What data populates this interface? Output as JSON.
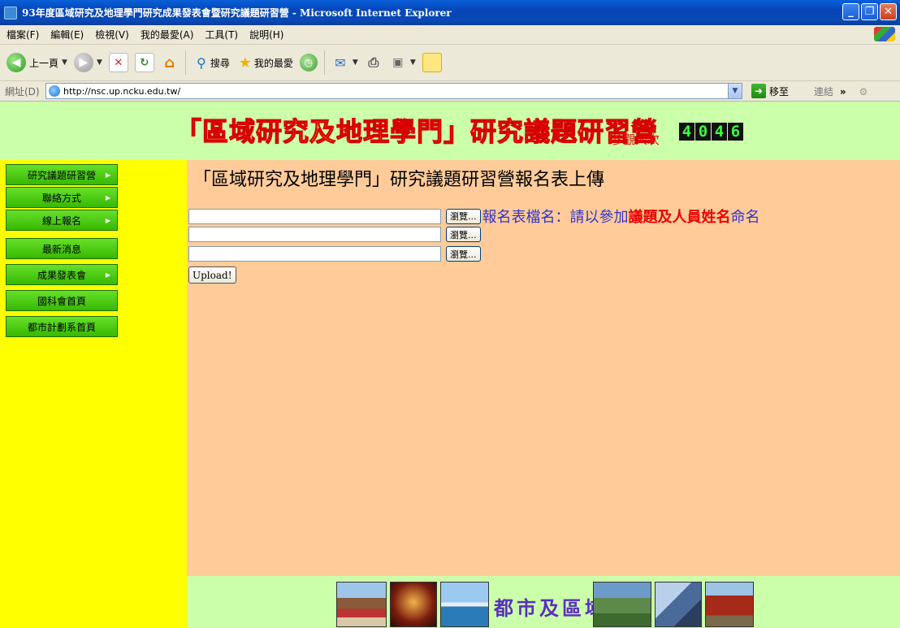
{
  "window": {
    "title": "93年度區域研究及地理學門研究成果發表會暨研究議題研習營 - Microsoft Internet Explorer"
  },
  "menu": [
    "檔案(F)",
    "編輯(E)",
    "檢視(V)",
    "我的最愛(A)",
    "工具(T)",
    "說明(H)"
  ],
  "toolbar": {
    "back": "上一頁",
    "search": "搜尋",
    "favorites": "我的最愛"
  },
  "address": {
    "label": "網址(D)",
    "url": "http://nsc.up.ncku.edu.tw/",
    "go": "移至",
    "links": "連結"
  },
  "banner": {
    "title": "「區域研究及地理學門」研究議題研習營",
    "visits_label": "參觀人次",
    "counter": [
      "4",
      "0",
      "4",
      "6"
    ]
  },
  "nav": [
    {
      "label": "研究議題研習營",
      "arrow": true
    },
    {
      "label": "聯絡方式",
      "arrow": true
    },
    {
      "label": "線上報名",
      "arrow": true
    },
    {
      "label": "最新消息",
      "arrow": false
    },
    {
      "label": "成果發表會",
      "arrow": true
    },
    {
      "label": "國科會首頁",
      "arrow": false
    },
    {
      "label": "都市計劃系首頁",
      "arrow": false
    }
  ],
  "main": {
    "heading": "「區域研究及地理學門」研究議題研習營報名表上傳",
    "browse_label": "瀏覽...",
    "hint_prefix": "報名表檔名：請以參加",
    "hint_highlight": "議題及人員姓名",
    "hint_suffix": "命名",
    "upload_label": "Upload!"
  },
  "footer": {
    "text": "都市及區域"
  },
  "colors": {
    "banner_bg": "#ccffaa",
    "sidebar_bg": "#ffff00",
    "content_bg": "#ffcc99",
    "nav_green": "#38b800",
    "title_yellow": "#ffdd00",
    "title_red": "#d80000"
  }
}
